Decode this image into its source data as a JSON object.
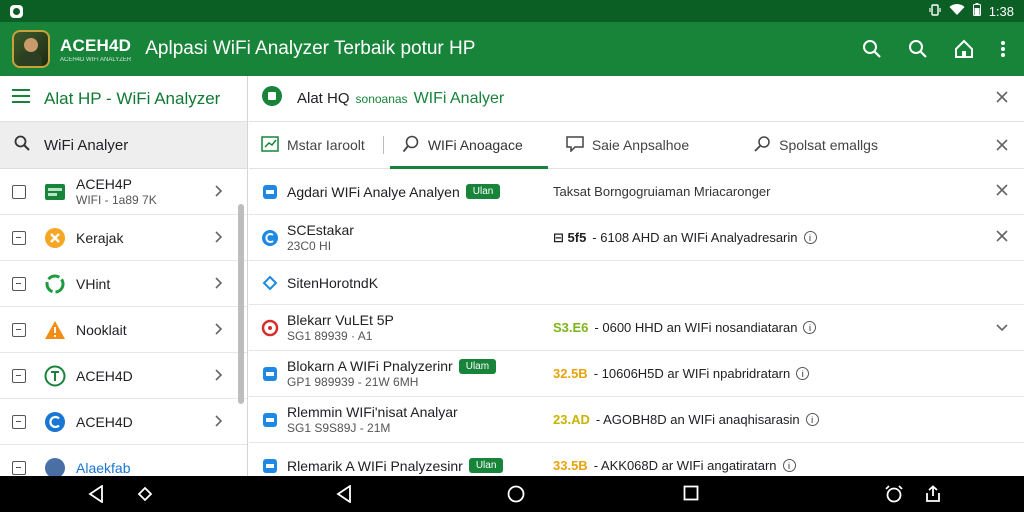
{
  "status_bar": {
    "time": "1:38",
    "icons": [
      "app-icon",
      "vibrate-icon",
      "wifi-icon",
      "battery-icon"
    ]
  },
  "app_bar": {
    "brand_name": "ACEH4D",
    "brand_sub": "ACEH4D WIFI ANALYZER",
    "title": "Aplpasi WiFi Analyzer Terbaik potur HP",
    "actions": [
      "search-icon",
      "search-icon",
      "home-icon",
      "more-vert-icon"
    ]
  },
  "left_panel": {
    "header_title": "Alat HP - WiFi Analyzer",
    "search_label": "WiFi Analyer",
    "items": [
      {
        "label": "ACEH4P",
        "sub": "WIFI - 1a89 7K",
        "icon": "wifi-card-icon"
      },
      {
        "label": "Kerajak",
        "sub": "",
        "icon": "star-icon"
      },
      {
        "label": "VHint",
        "sub": "",
        "icon": "recycle-icon"
      },
      {
        "label": "Nooklait",
        "sub": "",
        "icon": "warning-icon"
      },
      {
        "label": "ACEH4D",
        "sub": "",
        "icon": "circle-t-icon"
      },
      {
        "label": "ACEH4D",
        "sub": "",
        "icon": "circle-c-icon"
      },
      {
        "label": "Alaekfab",
        "sub": "",
        "icon": "circle-a-icon"
      }
    ]
  },
  "right_panel": {
    "header": {
      "a": "Alat HQ",
      "b": "sonoanas",
      "c": "WIFi Analyer"
    },
    "tabs": [
      {
        "label": "Mstar Iaroolt",
        "icon": "chart-icon"
      },
      {
        "label": "WIFi Anoagace",
        "icon": "search-icon",
        "active": true
      },
      {
        "label": "Saie Anpsalhoe",
        "icon": "chat-icon"
      },
      {
        "label": "Spolsat emallgs",
        "icon": "pin-icon"
      }
    ],
    "rows": [
      {
        "title": "Agdari WIFi Analye Analyen",
        "sub": "",
        "badge": "Ulan",
        "mid_plain": "Taksat Borngogruiaman Mriacaronger",
        "end": "close",
        "icon": "blue-square-icon"
      },
      {
        "title": "SCEstakar",
        "sub": "23C0 HI",
        "value": "⊟ 5f5",
        "value_color": "#202124",
        "detail": "- 6108 AHD an WIFi Analyadresarin",
        "end": "close",
        "icon": "blue-c-icon"
      },
      {
        "title": "SitenHorotndK",
        "sub": "",
        "icon": "diamond-icon"
      },
      {
        "title": "Blekarr VuLEt 5P",
        "sub": "SG1 89939 · A1",
        "value": "S3.E6",
        "value_color": "#7cb518",
        "detail": "- 0600 HHD an WIFi nosandiataran",
        "end": "chevron",
        "icon": "red-ring-icon"
      },
      {
        "title": "Blokarn A WIFi Pnalyzerinr",
        "sub": "GP1 989939 - 21W 6MH",
        "badge": "Ulam",
        "value": "32.5B",
        "value_color": "#e8a30c",
        "detail": "- 10606H5D ar WIFi npabridratarn",
        "end": "",
        "icon": "blue-square-icon"
      },
      {
        "title": "Rlemmin WIFi'nisat Analyar",
        "sub": "SG1 S9S89J - 21M",
        "value": "23.AD",
        "value_color": "#c9b400",
        "detail": "- AGOBH8D an WIFi anaqhisarasin",
        "end": "",
        "icon": "blue-square-icon"
      },
      {
        "title": "Rlemarik A WIFi Pnalyzesinr",
        "sub": "",
        "badge": "Ulan",
        "value": "33.5B",
        "value_color": "#e8a30c",
        "detail": "- AKK068D ar WIFi angatiratarn",
        "end": "",
        "icon": "blue-square-icon"
      }
    ]
  },
  "nav_bar": {
    "buttons": [
      "back-icon",
      "rotate-icon",
      "back-icon",
      "home-circle-icon",
      "recents-icon",
      "alarm-icon",
      "share-icon"
    ]
  },
  "colors": {
    "status_bar": "#0b5e24",
    "app_bar": "#17843a",
    "accent": "#17843a"
  }
}
